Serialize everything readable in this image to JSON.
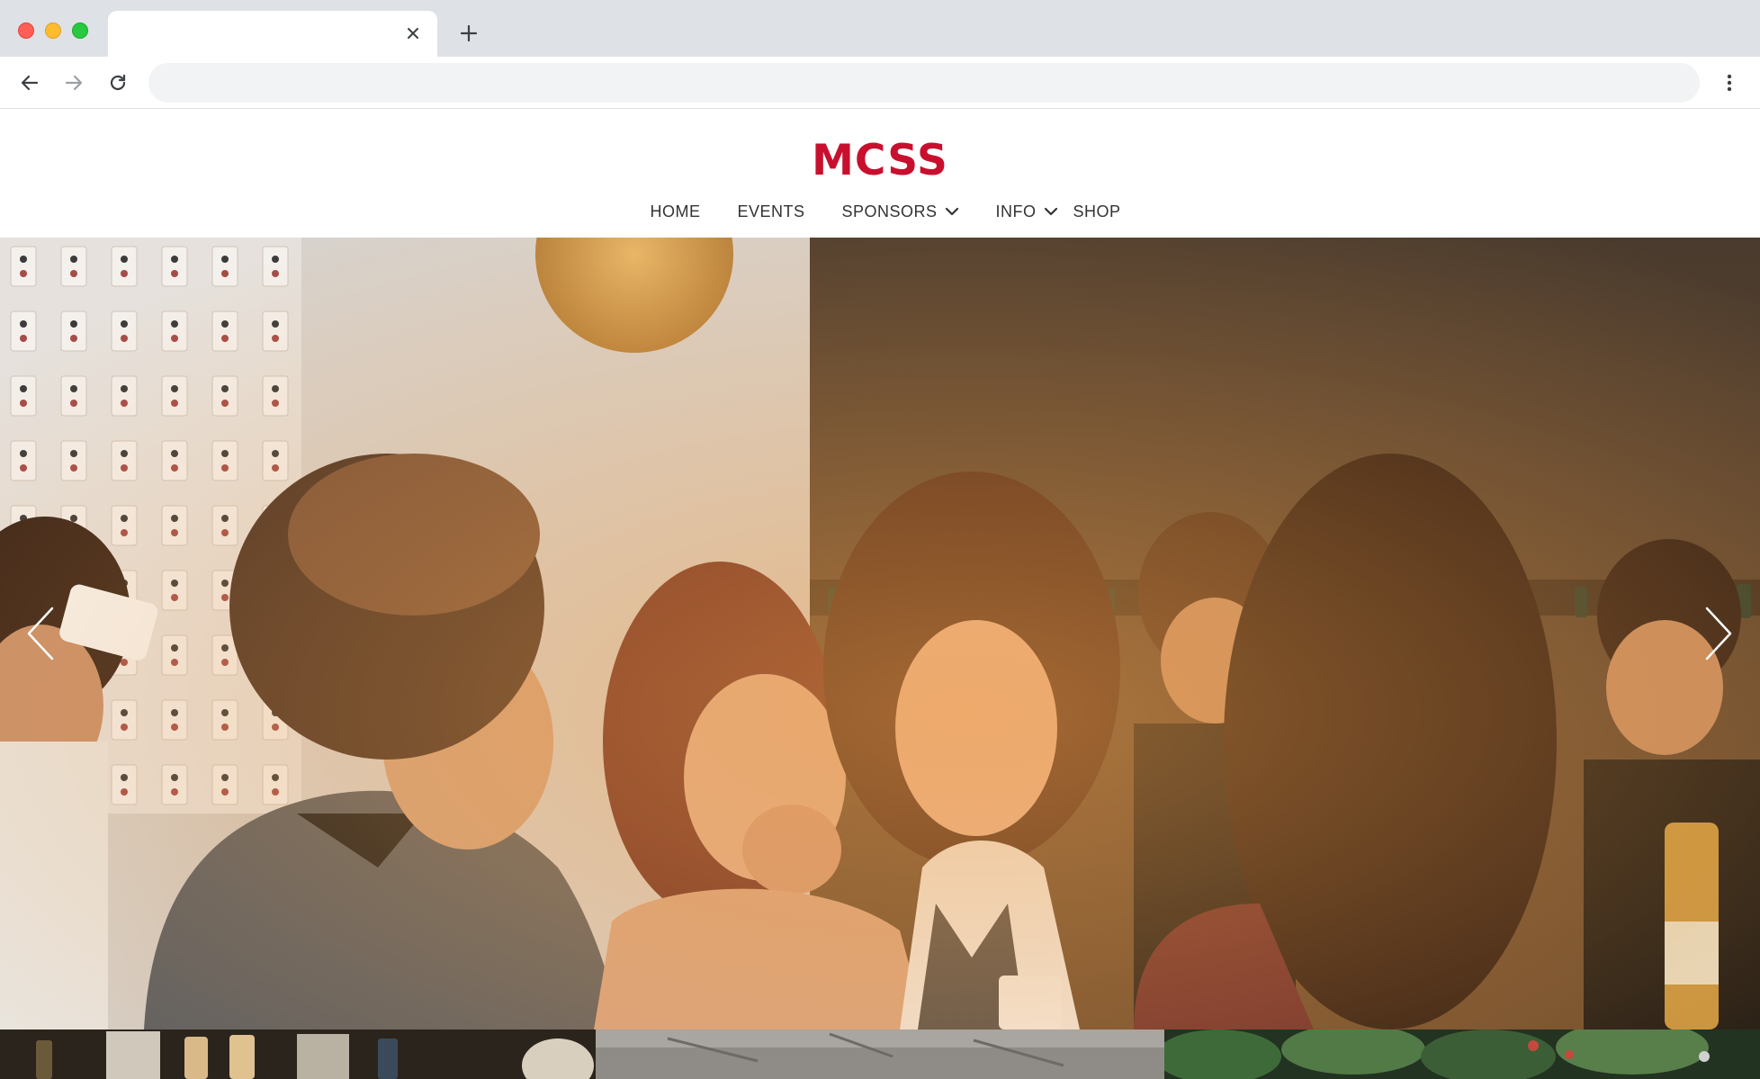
{
  "browser": {
    "tab_title": "",
    "url": ""
  },
  "site": {
    "logo_text": "MCSS",
    "brand_color": "#c8102e"
  },
  "nav": {
    "items": [
      {
        "label": "HOME",
        "has_dropdown": false
      },
      {
        "label": "EVENTS",
        "has_dropdown": false
      },
      {
        "label": "SPONSORS",
        "has_dropdown": true
      },
      {
        "label": "INFO",
        "has_dropdown": true
      },
      {
        "label": "SHOP",
        "has_dropdown": false
      }
    ]
  },
  "hero": {
    "icons": {
      "prev": "chevron-left-icon",
      "next": "chevron-right-icon"
    }
  }
}
